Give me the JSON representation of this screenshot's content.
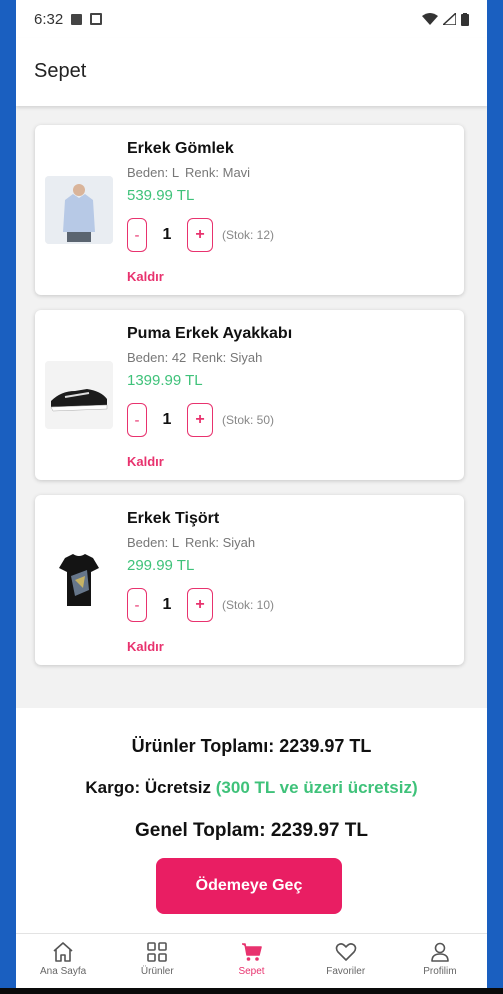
{
  "status_bar": {
    "time": "6:32"
  },
  "app_bar": {
    "title": "Sepet"
  },
  "cart_items": [
    {
      "name": "Erkek Gömlek",
      "size": "Beden: L",
      "color": "Renk: Mavi",
      "price": "539.99 TL",
      "minus": "-",
      "quantity": "1",
      "plus": "+",
      "stock": "(Stok: 12)",
      "remove": "Kaldır"
    },
    {
      "name": "Puma Erkek Ayakkabı",
      "size": "Beden: 42",
      "color": "Renk: Siyah",
      "price": "1399.99 TL",
      "minus": "-",
      "quantity": "1",
      "plus": "+",
      "stock": "(Stok: 50)",
      "remove": "Kaldır"
    },
    {
      "name": "Erkek Tişört",
      "size": "Beden: L",
      "color": "Renk: Siyah",
      "price": "299.99 TL",
      "minus": "-",
      "quantity": "1",
      "plus": "+",
      "stock": "(Stok: 10)",
      "remove": "Kaldır"
    }
  ],
  "summary": {
    "products_total": "Ürünler Toplamı: 2239.97 TL",
    "shipping_label": "Kargo: Ücretsiz",
    "shipping_note": "(300 TL ve üzeri ücretsiz)",
    "grand_total": "Genel Toplam: 2239.97 TL",
    "checkout_label": "Ödemeye Geç"
  },
  "bottom_nav": [
    {
      "label": "Ana Sayfa",
      "icon": "home-icon"
    },
    {
      "label": "Ürünler",
      "icon": "grid-icon"
    },
    {
      "label": "Sepet",
      "icon": "cart-icon",
      "active": true
    },
    {
      "label": "Favoriler",
      "icon": "heart-icon"
    },
    {
      "label": "Profilim",
      "icon": "person-icon"
    }
  ],
  "colors": {
    "accent": "#e91e63",
    "price_green": "#3fc27a",
    "frame_blue": "#1a5fc0"
  }
}
